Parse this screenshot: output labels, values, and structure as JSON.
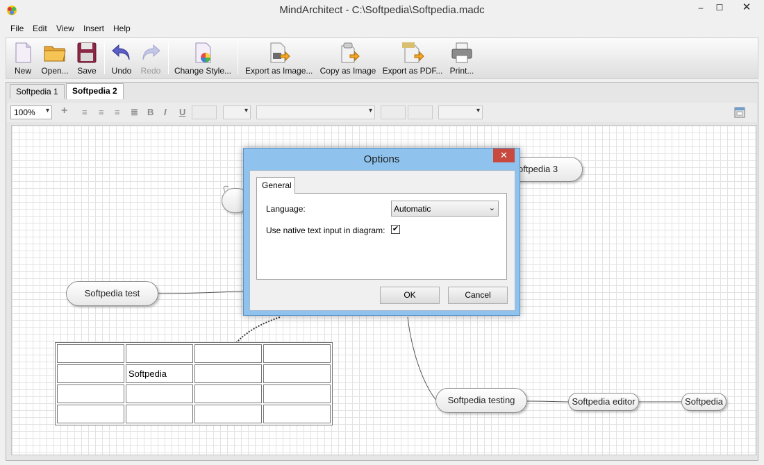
{
  "window": {
    "title": "MindArchitect - C:\\Softpedia\\Softpedia.madc",
    "minimize": "–",
    "maximize": "☐",
    "close": "✕"
  },
  "menu": [
    "File",
    "Edit",
    "View",
    "Insert",
    "Help"
  ],
  "toolbar": {
    "new": "New",
    "open": "Open...",
    "save": "Save",
    "undo": "Undo",
    "redo": "Redo",
    "change_style": "Change Style...",
    "export_image": "Export as Image...",
    "copy_image": "Copy as Image",
    "export_pdf": "Export as PDF...",
    "print": "Print..."
  },
  "doc_tabs": [
    "Softpedia 1",
    "Softpedia 2"
  ],
  "format_bar": {
    "zoom": "100%"
  },
  "diagram": {
    "nodes": {
      "softpedia3": "oftpedia 3",
      "softpedia_test": "Softpedia test",
      "softpedia_testing": "Softpedia testing",
      "softpedia_editor": "Softpedia editor",
      "softpedia": "Softpedia"
    },
    "table_cell": "Softpedia"
  },
  "dialog": {
    "title": "Options",
    "close": "✕",
    "tab": "General",
    "language_label": "Language:",
    "language_value": "Automatic",
    "native_input_label": "Use native text input in diagram:",
    "native_input_checked": true,
    "ok": "OK",
    "cancel": "Cancel"
  }
}
